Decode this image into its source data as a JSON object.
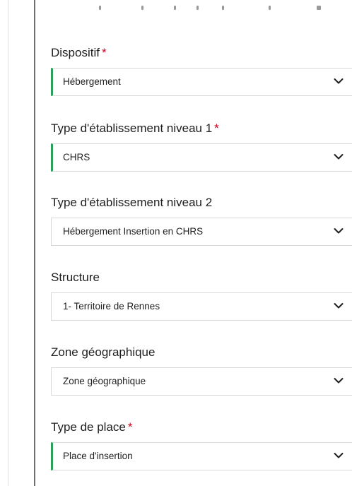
{
  "form": {
    "fields": [
      {
        "label": "Dispositif",
        "required": true,
        "required_mark": "*",
        "value": "Hébergement",
        "accent": true
      },
      {
        "label": "Type d'établissement niveau 1",
        "required": true,
        "required_mark": "*",
        "value": "CHRS",
        "accent": true
      },
      {
        "label": "Type d'établissement niveau 2",
        "required": false,
        "value": "Hébergement Insertion en CHRS",
        "accent": false
      },
      {
        "label": "Structure",
        "required": false,
        "value": "1- Territoire de Rennes",
        "accent": false
      },
      {
        "label": "Zone géographique",
        "required": false,
        "value": "Zone géographique",
        "accent": false
      },
      {
        "label": "Type de place",
        "required": true,
        "required_mark": "*",
        "value": "Place d'insertion",
        "accent": true
      }
    ]
  },
  "colors": {
    "required": "#d0021b",
    "accent_border": "#2e9e5b",
    "field_border": "#d8d8d8"
  },
  "icons": {
    "dropdown": "chevron-down-icon"
  }
}
